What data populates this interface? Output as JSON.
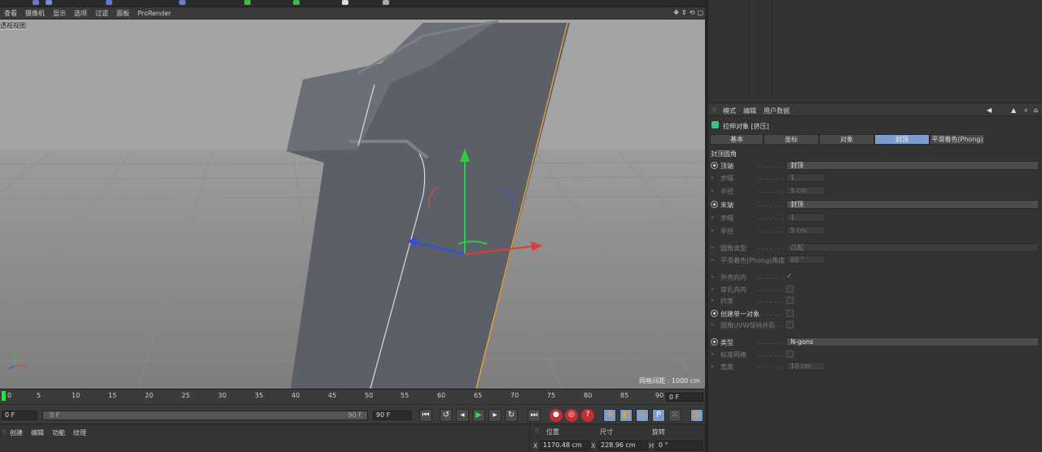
{
  "viewport_menu": [
    "查看",
    "摄像机",
    "显示",
    "选项",
    "过滤",
    "面板",
    "ProRender"
  ],
  "viewport": {
    "label": "透视视图",
    "grid_info": "网格间距 : 1000 cm",
    "nav_icons": [
      "move-nav-icon",
      "zoom-nav-icon",
      "rotate-nav-icon",
      "maximize-icon"
    ]
  },
  "timeline": {
    "ticks": [
      "0",
      "5",
      "10",
      "15",
      "20",
      "25",
      "30",
      "35",
      "40",
      "45",
      "50",
      "55",
      "60",
      "65",
      "70",
      "75",
      "80",
      "85",
      "90"
    ],
    "current_frame": "0 F",
    "start_field": "0 F",
    "range_start": "0 F",
    "range_end": "90 F",
    "end_field": "90 F"
  },
  "bottom_menu": [
    "创建",
    "编辑",
    "功能",
    "纹理"
  ],
  "coords": {
    "headers": [
      "位置",
      "尺寸",
      "旋转"
    ],
    "x_pos": "1170.48 cm",
    "x_size": "228.96 cm",
    "h_rot": "0 °",
    "x_label": "X",
    "size_x_label": "X",
    "h_label": "H"
  },
  "attributes": {
    "menu": [
      "模式",
      "编辑",
      "用户数据"
    ],
    "object_title": "拉伸对象 [挤压]",
    "tabs": [
      "基本",
      "坐标",
      "对象",
      "封顶",
      "平滑着色(Phong)"
    ],
    "active_tab": 3,
    "section": "封顶圆角",
    "rows": [
      {
        "label": "顶端",
        "value": "封顶",
        "kind": "radio"
      },
      {
        "label": "步幅",
        "value": "1",
        "kind": "dimfield"
      },
      {
        "label": "半径",
        "value": "5 cm",
        "kind": "dimfield"
      },
      {
        "label": "末端",
        "value": "封顶",
        "kind": "radio"
      },
      {
        "label": "步幅",
        "value": "1",
        "kind": "dimfield"
      },
      {
        "label": "半径",
        "value": "5 cm",
        "kind": "dimfield"
      },
      {
        "label": "圆角类型",
        "value": "凸起",
        "kind": "dimwide"
      },
      {
        "label": "平滑着色(Phong)角度",
        "value": "60 °",
        "kind": "dimfield"
      },
      {
        "label": "外壳向内",
        "value": "✓",
        "kind": "dimcheck"
      },
      {
        "label": "穿孔向内",
        "value": "",
        "kind": "dimcheck"
      },
      {
        "label": "约束",
        "value": "",
        "kind": "dimcheck"
      },
      {
        "label": "创建单一对象",
        "value": "",
        "kind": "radiocheck"
      },
      {
        "label": "圆角UVW保持外形",
        "value": "",
        "kind": "dimcheck"
      },
      {
        "label": "类型",
        "value": "N-gons",
        "kind": "radio"
      },
      {
        "label": "标准网格",
        "value": "",
        "kind": "dimcheck"
      },
      {
        "label": "宽度",
        "value": "10 cm",
        "kind": "dimfield"
      }
    ]
  },
  "colors": {
    "accent_tab": "#7e9ccb",
    "playhead": "#2fdc4a",
    "axis_x": "#e03a3a",
    "axis_y": "#2ecc40",
    "axis_z": "#2f4fe0",
    "selection_edge": "#e8a23a"
  }
}
